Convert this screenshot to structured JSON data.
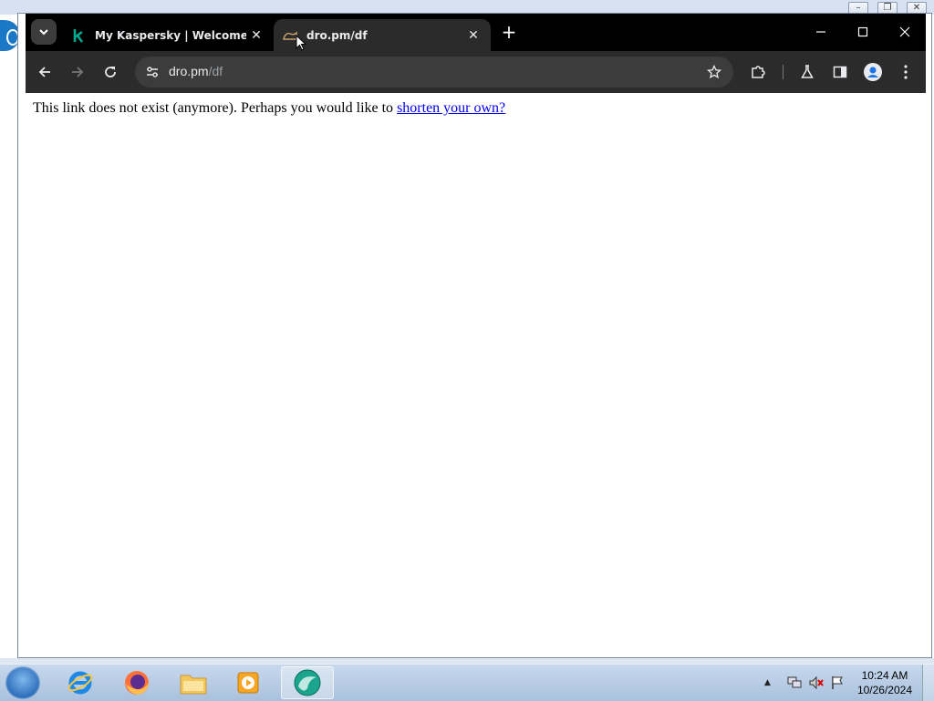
{
  "tabs": [
    {
      "title": "My Kaspersky | Welcome",
      "favicon": "kaspersky-icon",
      "active": false
    },
    {
      "title": "dro.pm/df",
      "favicon": "dro-pm-icon",
      "active": true
    }
  ],
  "omnibox": {
    "host": "dro.pm",
    "path": "/df"
  },
  "page": {
    "message": "This link does not exist (anymore). Perhaps you would like to ",
    "link_text": "shorten your own?"
  },
  "taskbar": {
    "apps": [
      "internet-explorer-icon",
      "firefox-icon",
      "file-explorer-icon",
      "media-player-icon",
      "chrome-icon"
    ],
    "clock_time": "10:24 AM",
    "clock_date": "10/26/2024"
  },
  "colors": {
    "tabstrip": "#000000",
    "toolbar": "#2b2b2b",
    "link": "#0000ee",
    "kaspersky": "#00a88e"
  }
}
